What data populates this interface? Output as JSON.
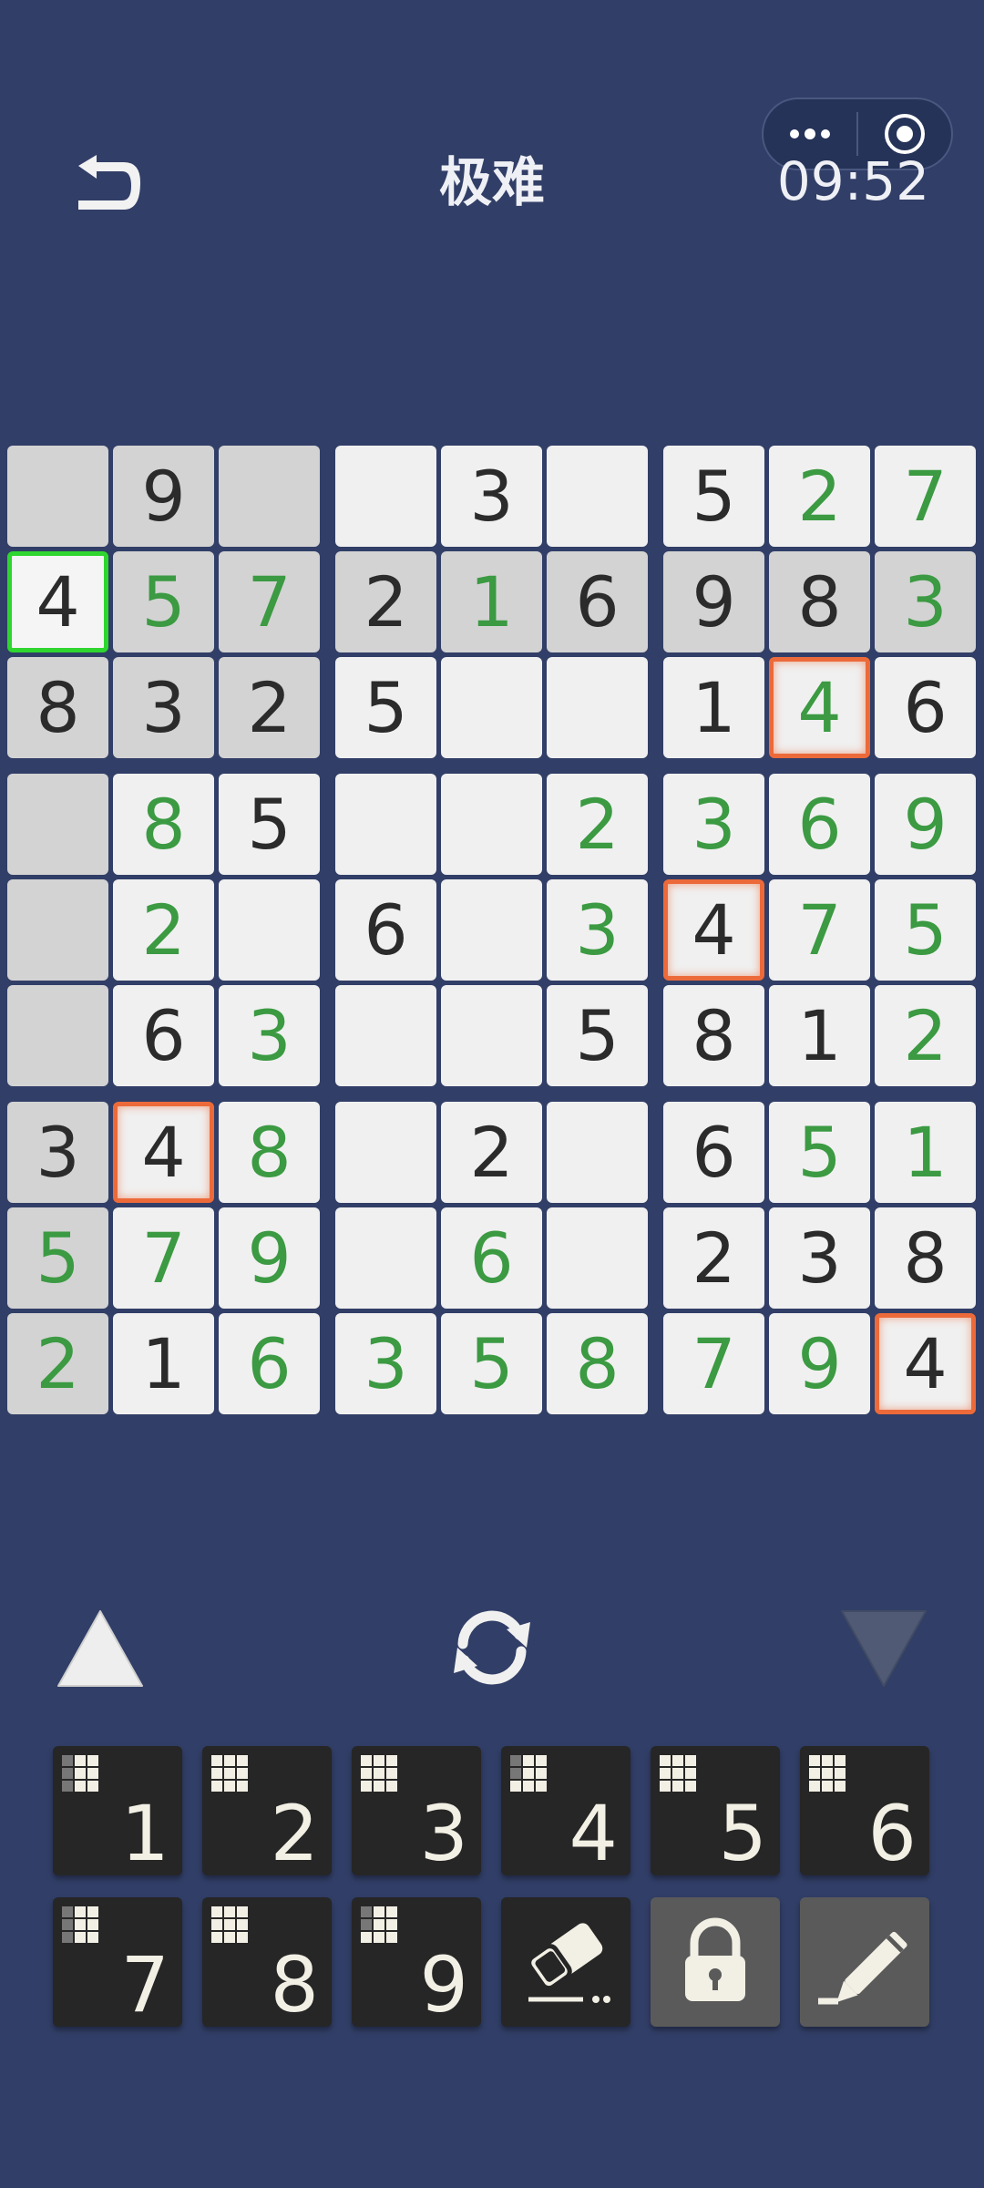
{
  "header": {
    "title": "极难",
    "timer": "09:52"
  },
  "board": {
    "rows": [
      [
        "",
        "9",
        "",
        "",
        "3",
        "",
        "5",
        "2",
        "7"
      ],
      [
        "4",
        "5",
        "7",
        "2",
        "1",
        "6",
        "9",
        "8",
        "3"
      ],
      [
        "8",
        "3",
        "2",
        "5",
        "",
        "",
        "1",
        "4",
        "6"
      ],
      [
        "",
        "8",
        "5",
        "",
        "",
        "2",
        "3",
        "6",
        "9"
      ],
      [
        "",
        "2",
        "",
        "6",
        "",
        "3",
        "4",
        "7",
        "5"
      ],
      [
        "",
        "6",
        "3",
        "",
        "",
        "5",
        "8",
        "1",
        "2"
      ],
      [
        "3",
        "4",
        "8",
        "",
        "2",
        "",
        "6",
        "5",
        "1"
      ],
      [
        "5",
        "7",
        "9",
        "",
        "6",
        "",
        "2",
        "3",
        "8"
      ],
      [
        "2",
        "1",
        "6",
        "3",
        "5",
        "8",
        "7",
        "9",
        "4"
      ]
    ],
    "player_entered": [
      [
        0,
        0,
        0,
        0,
        0,
        0,
        0,
        1,
        1
      ],
      [
        0,
        1,
        1,
        0,
        1,
        0,
        0,
        0,
        1
      ],
      [
        0,
        0,
        0,
        0,
        0,
        0,
        0,
        1,
        0
      ],
      [
        0,
        1,
        0,
        0,
        0,
        1,
        1,
        1,
        1
      ],
      [
        0,
        1,
        0,
        0,
        0,
        1,
        0,
        1,
        1
      ],
      [
        0,
        0,
        1,
        0,
        0,
        0,
        0,
        0,
        1
      ],
      [
        0,
        0,
        1,
        0,
        0,
        0,
        0,
        1,
        1
      ],
      [
        1,
        1,
        1,
        0,
        1,
        0,
        0,
        0,
        0
      ],
      [
        1,
        0,
        1,
        1,
        1,
        1,
        1,
        1,
        0
      ]
    ],
    "highlighted": [
      [
        1,
        1,
        1,
        0,
        0,
        0,
        0,
        0,
        0
      ],
      [
        0,
        1,
        1,
        1,
        1,
        1,
        1,
        1,
        1
      ],
      [
        1,
        1,
        1,
        0,
        0,
        0,
        0,
        0,
        0
      ],
      [
        1,
        0,
        0,
        0,
        0,
        0,
        0,
        0,
        0
      ],
      [
        1,
        0,
        0,
        0,
        0,
        0,
        0,
        0,
        0
      ],
      [
        1,
        0,
        0,
        0,
        0,
        0,
        0,
        0,
        0
      ],
      [
        1,
        0,
        0,
        0,
        0,
        0,
        0,
        0,
        0
      ],
      [
        1,
        0,
        0,
        0,
        0,
        0,
        0,
        0,
        0
      ],
      [
        1,
        0,
        0,
        0,
        0,
        0,
        0,
        0,
        0
      ]
    ],
    "selected_cell": [
      1,
      0
    ],
    "conflict_cells": [
      [
        2,
        7
      ],
      [
        4,
        6
      ],
      [
        6,
        1
      ],
      [
        8,
        8
      ]
    ],
    "colors": {
      "given": "#2b2b2b",
      "entered": "#3b9a42",
      "selected_border": "#2fd62f",
      "conflict_border": "#ec6a3a",
      "highlight": "#d3d3d3",
      "cell": "#f0f0f0",
      "background": "#313e67"
    }
  },
  "keypad": {
    "numbers": [
      {
        "label": "1",
        "grid": [
          1,
          1,
          1,
          1,
          1,
          1,
          1,
          1,
          1
        ],
        "dim": [
          1,
          0,
          0,
          1,
          0,
          0,
          1,
          0,
          0
        ]
      },
      {
        "label": "2",
        "grid": [
          1,
          1,
          1,
          1,
          1,
          1,
          1,
          1,
          1
        ],
        "dim": []
      },
      {
        "label": "3",
        "grid": [
          1,
          1,
          1,
          1,
          1,
          1,
          1,
          1,
          1
        ],
        "dim": []
      },
      {
        "label": "4",
        "grid": [
          1,
          1,
          1,
          1,
          1,
          1,
          1,
          1,
          1
        ],
        "dim": [
          1,
          0,
          0,
          1,
          0,
          0,
          0,
          0,
          0
        ]
      },
      {
        "label": "5",
        "grid": [
          1,
          1,
          1,
          1,
          1,
          1,
          1,
          1,
          1
        ],
        "dim": []
      },
      {
        "label": "6",
        "grid": [
          1,
          1,
          1,
          1,
          1,
          1,
          1,
          1,
          1
        ],
        "dim": []
      },
      {
        "label": "7",
        "grid": [
          1,
          1,
          1,
          1,
          1,
          1,
          1,
          1,
          1
        ],
        "dim": [
          1,
          0,
          0,
          1,
          0,
          0,
          1,
          0,
          0
        ]
      },
      {
        "label": "8",
        "grid": [
          1,
          1,
          1,
          1,
          1,
          1,
          1,
          1,
          1
        ],
        "dim": []
      },
      {
        "label": "9",
        "grid": [
          1,
          1,
          1,
          1,
          1,
          1,
          1,
          1,
          1
        ],
        "dim": [
          1,
          0,
          0,
          1,
          0,
          0,
          0,
          0,
          0
        ]
      }
    ],
    "tools": [
      "eraser-icon",
      "lock-icon",
      "pencil-icon"
    ]
  },
  "icons": {
    "back": "back-arrow-icon",
    "menu": "more-dots-icon",
    "close": "target-icon",
    "prev": "triangle-up-icon",
    "refresh": "refresh-icon",
    "next": "triangle-down-icon"
  }
}
